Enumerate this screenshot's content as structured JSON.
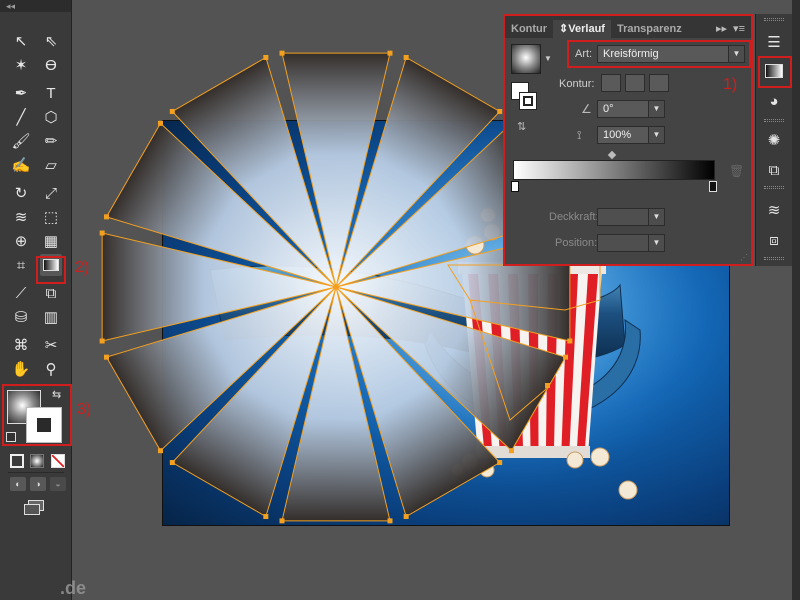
{
  "toolbar": {
    "collapse_label": "◂◂",
    "tools": [
      {
        "name": "selection-tool-icon",
        "glyph": "↖"
      },
      {
        "name": "direct-selection-tool-icon",
        "glyph": "⇖"
      },
      {
        "name": "magic-wand-tool-icon",
        "glyph": "✶"
      },
      {
        "name": "lasso-tool-icon",
        "glyph": "ϴ"
      },
      {
        "name": "pen-tool-icon",
        "glyph": "✒"
      },
      {
        "name": "type-tool-icon",
        "glyph": "T"
      },
      {
        "name": "line-segment-tool-icon",
        "glyph": "╱"
      },
      {
        "name": "polygon-tool-icon",
        "glyph": "⬡"
      },
      {
        "name": "paintbrush-tool-icon",
        "glyph": "🖌"
      },
      {
        "name": "pencil-tool-icon",
        "glyph": "✏"
      },
      {
        "name": "blob-brush-tool-icon",
        "glyph": "✍"
      },
      {
        "name": "eraser-tool-icon",
        "glyph": "▱"
      },
      {
        "name": "rotate-tool-icon",
        "glyph": "↻"
      },
      {
        "name": "scale-tool-icon",
        "glyph": "⤢"
      },
      {
        "name": "width-tool-icon",
        "glyph": "≋"
      },
      {
        "name": "free-transform-tool-icon",
        "glyph": "⬚"
      },
      {
        "name": "shape-builder-tool-icon",
        "glyph": "⊕"
      },
      {
        "name": "perspective-grid-tool-icon",
        "glyph": "▦"
      },
      {
        "name": "mesh-tool-icon",
        "glyph": "⌗"
      },
      {
        "name": "gradient-tool-icon",
        "glyph": ""
      },
      {
        "name": "eyedropper-tool-icon",
        "glyph": "⟋"
      },
      {
        "name": "blend-tool-icon",
        "glyph": "⧉"
      },
      {
        "name": "symbol-sprayer-tool-icon",
        "glyph": "⛁"
      },
      {
        "name": "column-graph-tool-icon",
        "glyph": "▥"
      },
      {
        "name": "artboard-tool-icon",
        "glyph": "⌘"
      },
      {
        "name": "slice-tool-icon",
        "glyph": "✂"
      },
      {
        "name": "hand-tool-icon",
        "glyph": "✋"
      },
      {
        "name": "zoom-tool-icon",
        "glyph": "⚲"
      }
    ],
    "callout_2": "2)",
    "callout_3": "3)"
  },
  "panel": {
    "tabs": [
      "Kontur",
      "Verlauf",
      "Transparenz"
    ],
    "active_tab": "Verlauf",
    "type_label": "Art:",
    "type_value": "Kreisförmig",
    "stroke_label": "Kontur:",
    "angle_value": "0°",
    "aspect_value": "100%",
    "opacity_label": "Deckkraft:",
    "position_label": "Position:",
    "callout_1": "1)",
    "colors": {
      "gradient_start": "#ffffff",
      "gradient_end": "#000000"
    }
  },
  "dock": {
    "icons": [
      "menu-icon",
      "gradient-panel-icon",
      "transparency-icon",
      "stroke-icon",
      "artboards-icon",
      "layers-icon",
      "links-icon"
    ]
  },
  "watermark": ".de"
}
